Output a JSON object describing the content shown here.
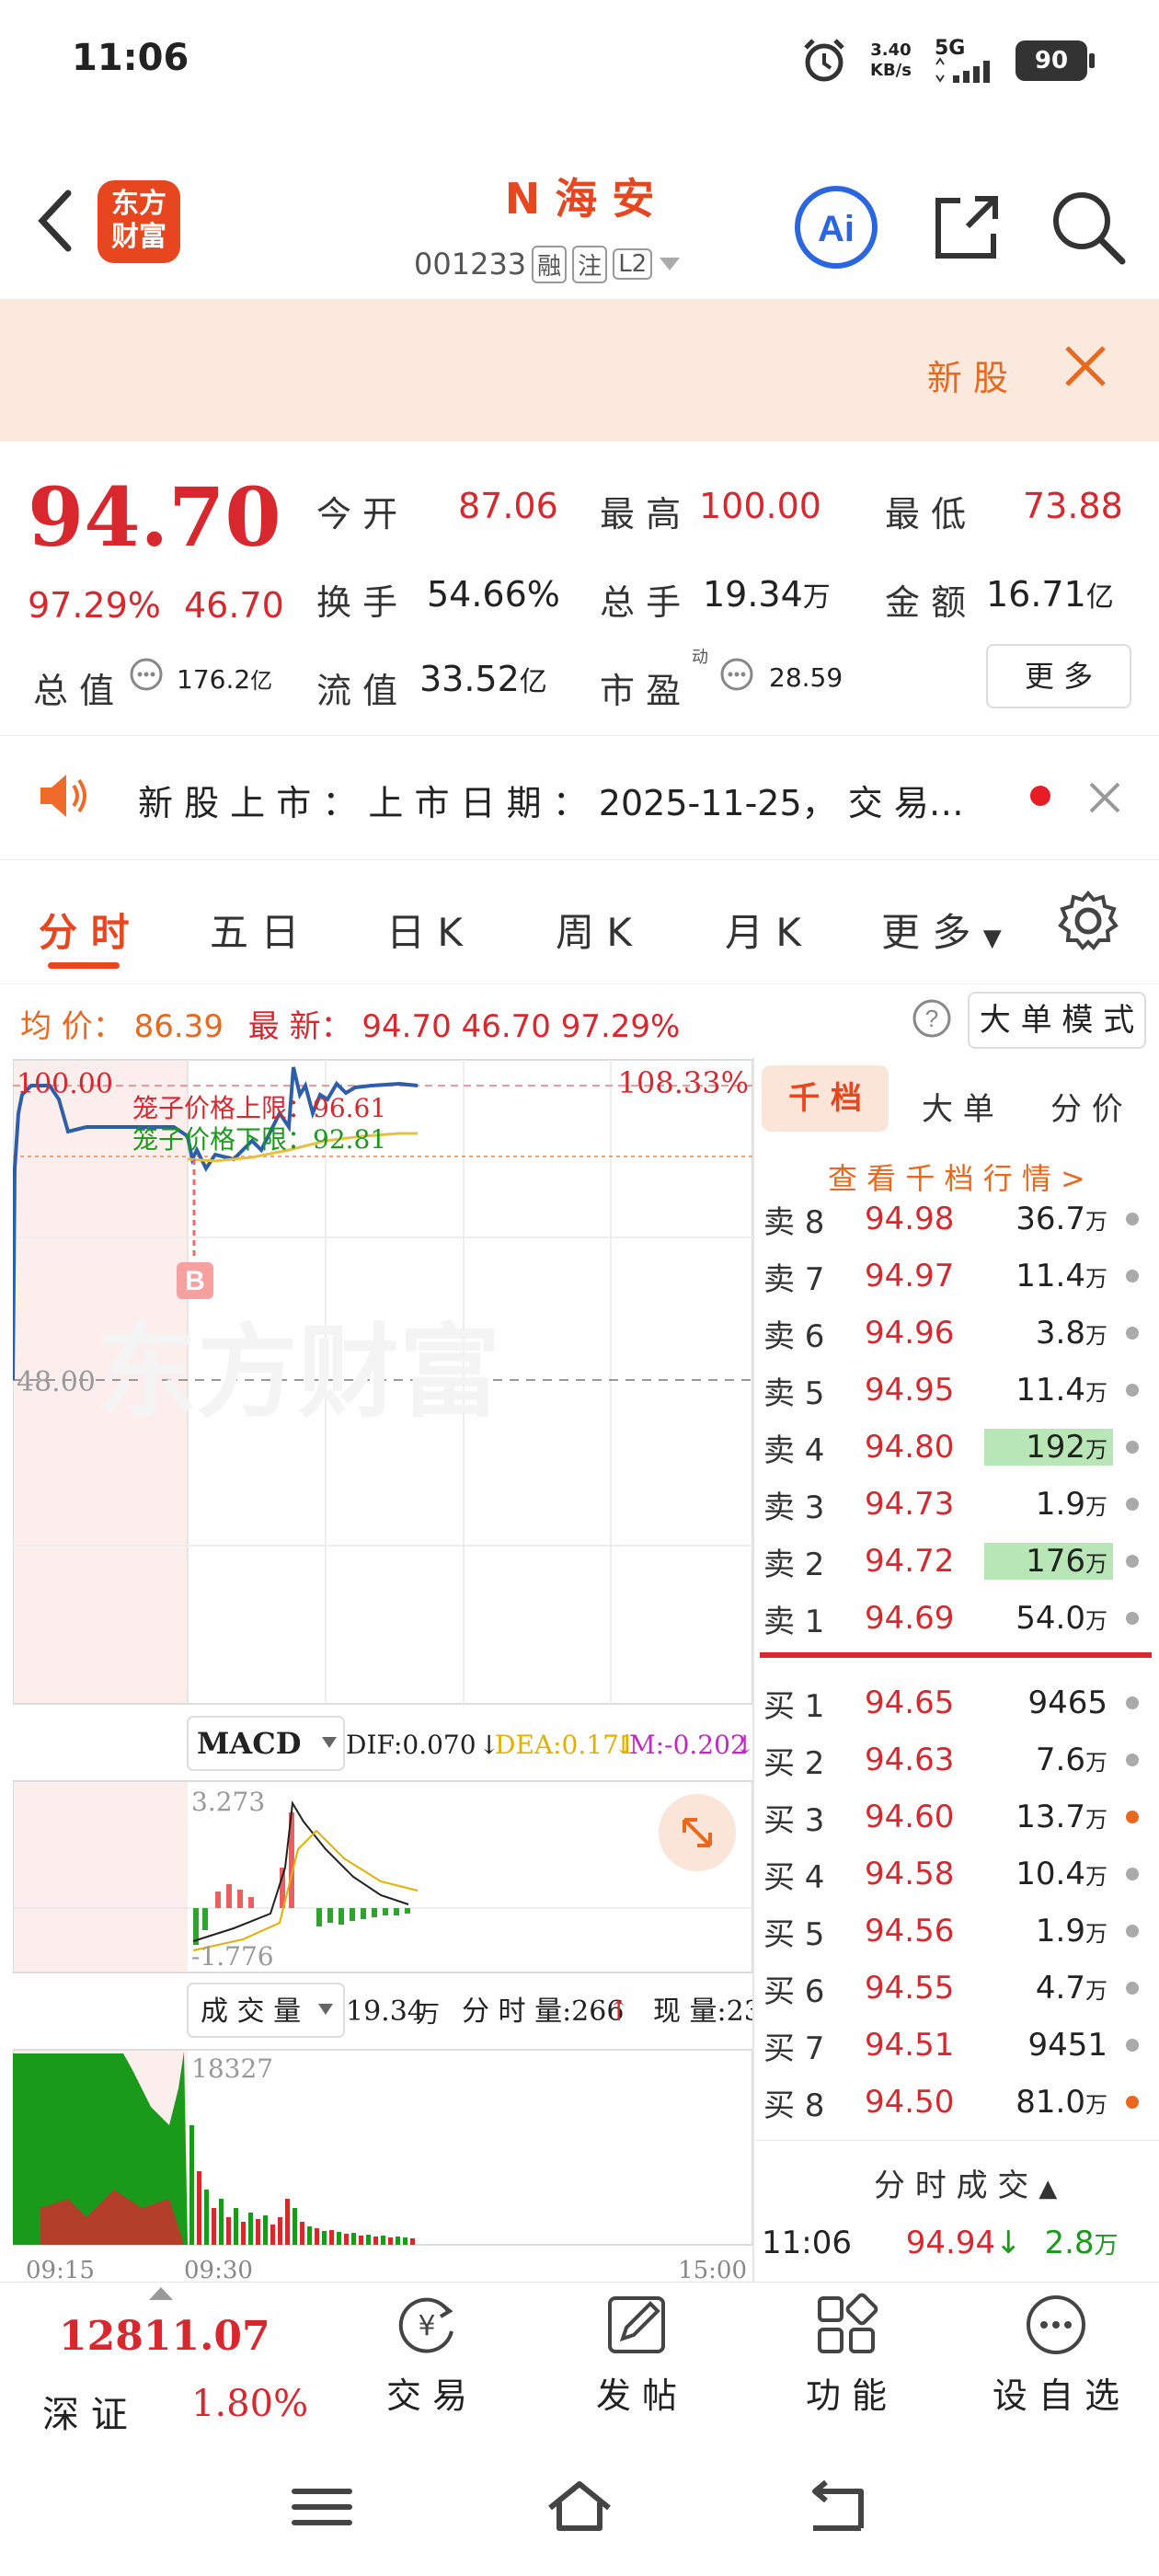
{
  "status_bar": {
    "time": "11:06",
    "net_speed": "3.40",
    "net_unit": "KB/s",
    "signal_label": "5G",
    "battery": "90"
  },
  "header": {
    "logo_line1": "东方",
    "logo_line2": "财富",
    "stock_prefix": "N",
    "stock_name": "海 安",
    "stock_code": "001233",
    "tags": [
      "融",
      "注",
      "L2"
    ]
  },
  "banner": {
    "label": "新 股"
  },
  "quote": {
    "price": "94.70",
    "change_pct": "97.29%",
    "change": "46.70",
    "open_label": "今 开",
    "open": "87.06",
    "high_label": "最 高",
    "high": "100.00",
    "low_label": "最 低",
    "low": "73.88",
    "turnover_label": "换 手",
    "turnover": "54.66%",
    "volume_label": "总 手",
    "volume": "19.34",
    "volume_unit": "万",
    "amount_label": "金 额",
    "amount": "16.71",
    "amount_unit": "亿",
    "mcap_label": "总 值",
    "mcap": "176.2",
    "mcap_unit": "亿",
    "float_label": "流 值",
    "float": "33.52",
    "float_unit": "亿",
    "pe_label": "市 盈",
    "pe_tag": "动",
    "pe": "28.59",
    "more": "更 多"
  },
  "ticker": {
    "text": "新 股 上 市 ：  上 市 日 期 ： 2025-11-25， 交 易…"
  },
  "tabs": [
    {
      "label": "分 时",
      "active": true
    },
    {
      "label": "五 日",
      "active": false
    },
    {
      "label": "日 K",
      "active": false
    },
    {
      "label": "周 K",
      "active": false
    },
    {
      "label": "月 K",
      "active": false
    },
    {
      "label": "更 多",
      "active": false
    }
  ],
  "info_line": {
    "avg_label": "均 价：",
    "avg": "86.39",
    "latest_label": "最 新：",
    "latest": "94.70",
    "chg": "46.70",
    "pct": "97.29%",
    "mode": "大 单 模 式"
  },
  "chart": {
    "price_top": "100.00",
    "price_mid": "48.00",
    "pct_top": "108.33%",
    "upper_limit_label": "笼子价格上限：96.61",
    "lower_limit_label": "笼子价格下限：92.81",
    "b_marker": "B",
    "watermark": "东方财富",
    "macd_label": "MACD",
    "dif": "DIF:0.070",
    "dea": "DEA:0.171",
    "m": "M:-0.202",
    "macd_top": "3.273",
    "macd_bottom": "-1.776",
    "vol_label": "成 交 量",
    "vol_total": "19.34",
    "vol_unit": "万",
    "vol_min": "分 时 量:266",
    "vol_now": "现 量:23",
    "vol_top": "18327",
    "time_start": "09:15",
    "time_mid": "09:30",
    "time_end": "15:00"
  },
  "chart_data": {
    "type": "line",
    "title": "",
    "x": [
      "09:15",
      "09:30",
      "15:00"
    ],
    "series": [],
    "ylim": [
      48.0,
      100.0
    ],
    "y_ticks": [
      "100.00",
      "48.00"
    ],
    "annotations": [
      "笼子价格上限：96.61",
      "笼子价格下限：92.81",
      "108.33%"
    ]
  },
  "side_panel": {
    "tabs": [
      "千 档",
      "大 单",
      "分 价"
    ],
    "depth_link": "查 看 千 档 行 情 >",
    "sell": [
      {
        "side": "卖 8",
        "price": "94.98",
        "vol": "36.7",
        "unit": "万"
      },
      {
        "side": "卖 7",
        "price": "94.97",
        "vol": "11.4",
        "unit": "万"
      },
      {
        "side": "卖 6",
        "price": "94.96",
        "vol": "3.8",
        "unit": "万"
      },
      {
        "side": "卖 5",
        "price": "94.95",
        "vol": "11.4",
        "unit": "万"
      },
      {
        "side": "卖 4",
        "price": "94.80",
        "vol": "192",
        "unit": "万"
      },
      {
        "side": "卖 3",
        "price": "94.73",
        "vol": "1.9",
        "unit": "万"
      },
      {
        "side": "卖 2",
        "price": "94.72",
        "vol": "176",
        "unit": "万"
      },
      {
        "side": "卖 1",
        "price": "94.69",
        "vol": "54.0",
        "unit": "万"
      }
    ],
    "buy": [
      {
        "side": "买 1",
        "price": "94.65",
        "vol": "9465",
        "unit": ""
      },
      {
        "side": "买 2",
        "price": "94.63",
        "vol": "7.6",
        "unit": "万"
      },
      {
        "side": "买 3",
        "price": "94.60",
        "vol": "13.7",
        "unit": "万"
      },
      {
        "side": "买 4",
        "price": "94.58",
        "vol": "10.4",
        "unit": "万"
      },
      {
        "side": "买 5",
        "price": "94.56",
        "vol": "1.9",
        "unit": "万"
      },
      {
        "side": "买 6",
        "price": "94.55",
        "vol": "4.7",
        "unit": "万"
      },
      {
        "side": "买 7",
        "price": "94.51",
        "vol": "9451",
        "unit": ""
      },
      {
        "side": "买 8",
        "price": "94.50",
        "vol": "81.0",
        "unit": "万"
      }
    ],
    "trades_label": "分 时 成 交",
    "trade": {
      "time": "11:06",
      "price": "94.94",
      "vol": "2.8",
      "unit": "万"
    }
  },
  "bottom_bar": {
    "index_value": "12811.07",
    "index_name": "深 证",
    "index_chg": "1.80%",
    "items": [
      "交 易",
      "发 帖",
      "功 能",
      "设 自 选"
    ]
  }
}
